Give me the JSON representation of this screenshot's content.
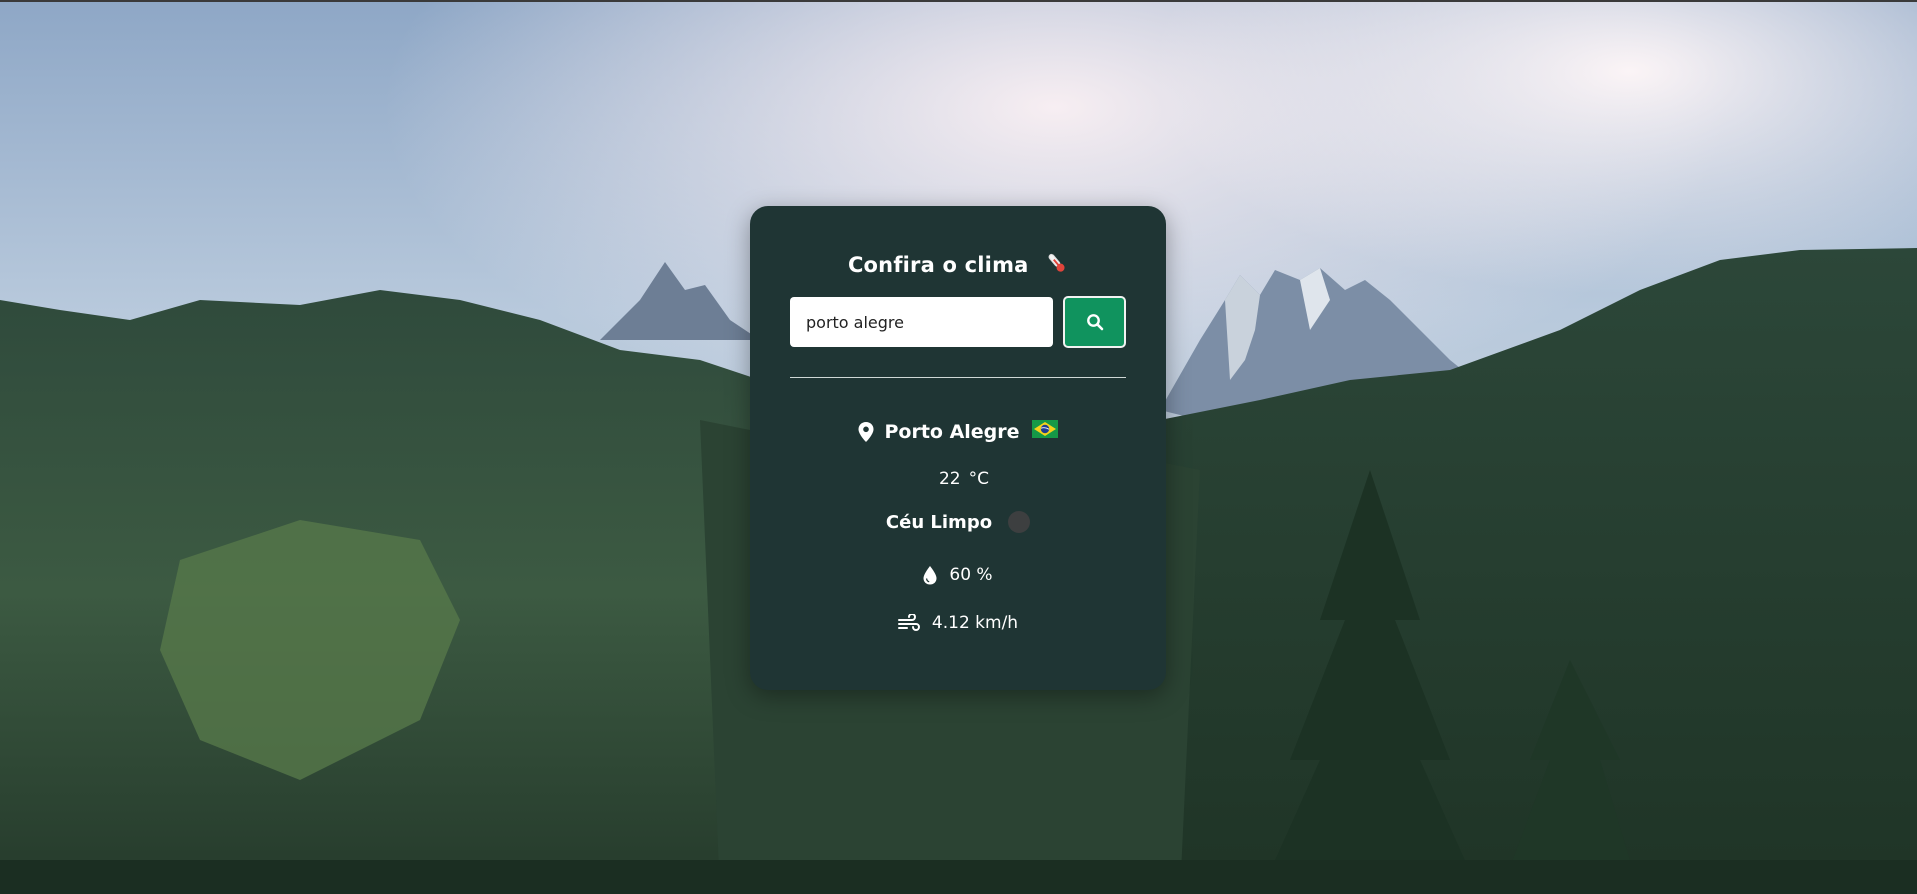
{
  "app": {
    "title": "Confira o clima",
    "accent_color": "#10935e",
    "card_color": "#1f3534"
  },
  "search": {
    "value": "porto alegre",
    "placeholder": "",
    "button_icon": "search-icon"
  },
  "weather": {
    "city": "Porto Alegre",
    "country_flag": "brazil-flag",
    "temperature": "22",
    "unit": "°C",
    "description": "Céu Limpo",
    "humidity": "60 %",
    "wind": "4.12 km/h"
  },
  "icons": {
    "title": "thermometer-icon",
    "location": "map-pin-icon",
    "humidity": "droplet-icon",
    "wind": "wind-icon"
  }
}
